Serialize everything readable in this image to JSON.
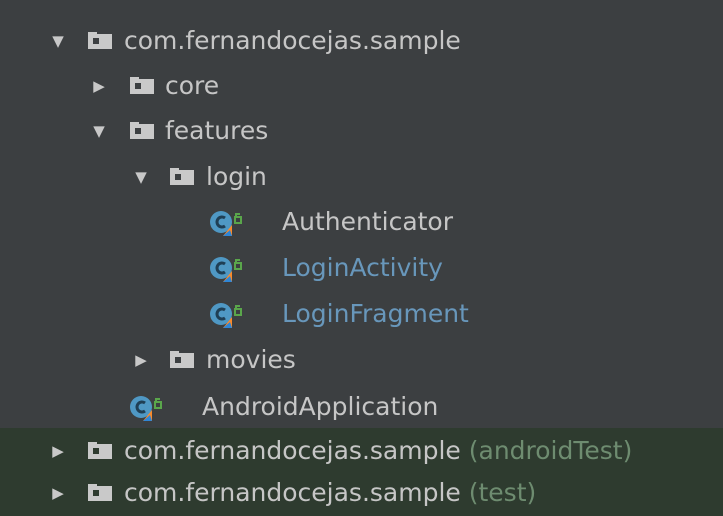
{
  "tree": {
    "arrows": {
      "expanded": "▼",
      "collapsed": "▶"
    },
    "colors": {
      "background": "#3c3f41",
      "selected_row": "#2e3b2f",
      "text": "#c6c6c6",
      "modified_text": "#6897bb",
      "suffix_text": "#6e8c70",
      "class_icon": "#4f98c4",
      "kotlin_badge": "#f88a2c",
      "access_icon": "#5aa64b"
    },
    "root_main": {
      "label": "com.fernandocejas.sample",
      "state": "expanded",
      "core": {
        "label": "core",
        "state": "collapsed"
      },
      "features": {
        "label": "features",
        "state": "expanded",
        "login": {
          "label": "login",
          "state": "expanded",
          "authenticator": {
            "label": "Authenticator",
            "icon": "kotlin-class-icon"
          },
          "login_activity": {
            "label": "LoginActivity",
            "icon": "kotlin-class-icon"
          },
          "login_fragment": {
            "label": "LoginFragment",
            "icon": "kotlin-class-icon"
          }
        },
        "movies": {
          "label": "movies",
          "state": "collapsed"
        }
      },
      "android_application": {
        "label": "AndroidApplication",
        "icon": "kotlin-class-icon"
      }
    },
    "root_android_test": {
      "label": "com.fernandocejas.sample",
      "suffix": "(androidTest)",
      "state": "collapsed"
    },
    "root_test": {
      "label": "com.fernandocejas.sample",
      "suffix": "(test)",
      "state": "collapsed"
    }
  }
}
